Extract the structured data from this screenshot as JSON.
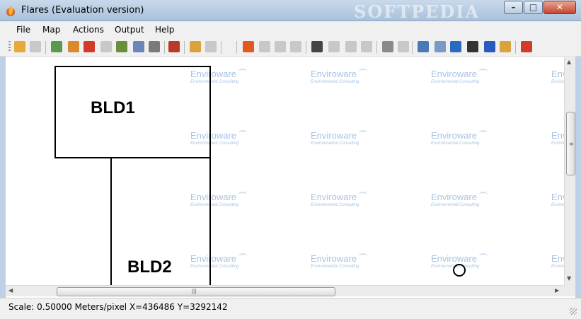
{
  "window": {
    "title": "Flares (Evaluation version)",
    "watermark": "SOFTPEDIA"
  },
  "menu": [
    "File",
    "Map",
    "Actions",
    "Output",
    "Help"
  ],
  "toolbar_icons": [
    {
      "name": "open-icon",
      "color": "#e6a93a"
    },
    {
      "name": "save-icon",
      "color": "#c8c8c8"
    },
    {
      "name": "image-icon",
      "color": "#5a9a4e"
    },
    {
      "name": "add-building-icon",
      "color": "#d98b2b"
    },
    {
      "name": "pin-icon",
      "color": "#d23b2a"
    },
    {
      "name": "eraser-icon",
      "color": "#c8c8c8"
    },
    {
      "name": "copy-icon",
      "color": "#6a8f3a"
    },
    {
      "name": "layers-icon",
      "color": "#6b86b6"
    },
    {
      "name": "print-icon",
      "color": "#7a7a7a"
    },
    {
      "name": "tools-icon",
      "color": "#b83a2a"
    },
    {
      "name": "ruler-icon",
      "color": "#d9a23a"
    },
    {
      "name": "bar-icon",
      "color": "#c8c8c8"
    },
    {
      "name": "flame-icon",
      "color": "#e05a1e"
    },
    {
      "name": "grid-icon",
      "color": "#c8c8c8"
    },
    {
      "name": "grid-2-icon",
      "color": "#c8c8c8"
    },
    {
      "name": "grid-3-icon",
      "color": "#c8c8c8"
    },
    {
      "name": "headphones-icon",
      "color": "#444444"
    },
    {
      "name": "grid-4-icon",
      "color": "#c8c8c8"
    },
    {
      "name": "grid-5-icon",
      "color": "#c8c8c8"
    },
    {
      "name": "grid-6-icon",
      "color": "#c8c8c8"
    },
    {
      "name": "filter-icon",
      "color": "#8a8a8a"
    },
    {
      "name": "grid-7-icon",
      "color": "#c8c8c8"
    },
    {
      "name": "book-icon",
      "color": "#4a7ab6"
    },
    {
      "name": "mail-icon",
      "color": "#7a9ac6"
    },
    {
      "name": "globe-icon",
      "color": "#2a6abf"
    },
    {
      "name": "binoculars-icon",
      "color": "#333333"
    },
    {
      "name": "help-icon",
      "color": "#2a5abf"
    },
    {
      "name": "key-icon",
      "color": "#d9a23a"
    },
    {
      "name": "exit-icon",
      "color": "#d23b2a"
    }
  ],
  "map": {
    "watermark_title": "Enviroware",
    "watermark_subtitle": "Environmental Consulting",
    "buildings": [
      "BLD1",
      "BLD2"
    ]
  },
  "status": {
    "text": "Scale: 0.50000 Meters/pixel  X=436486 Y=3292142"
  }
}
